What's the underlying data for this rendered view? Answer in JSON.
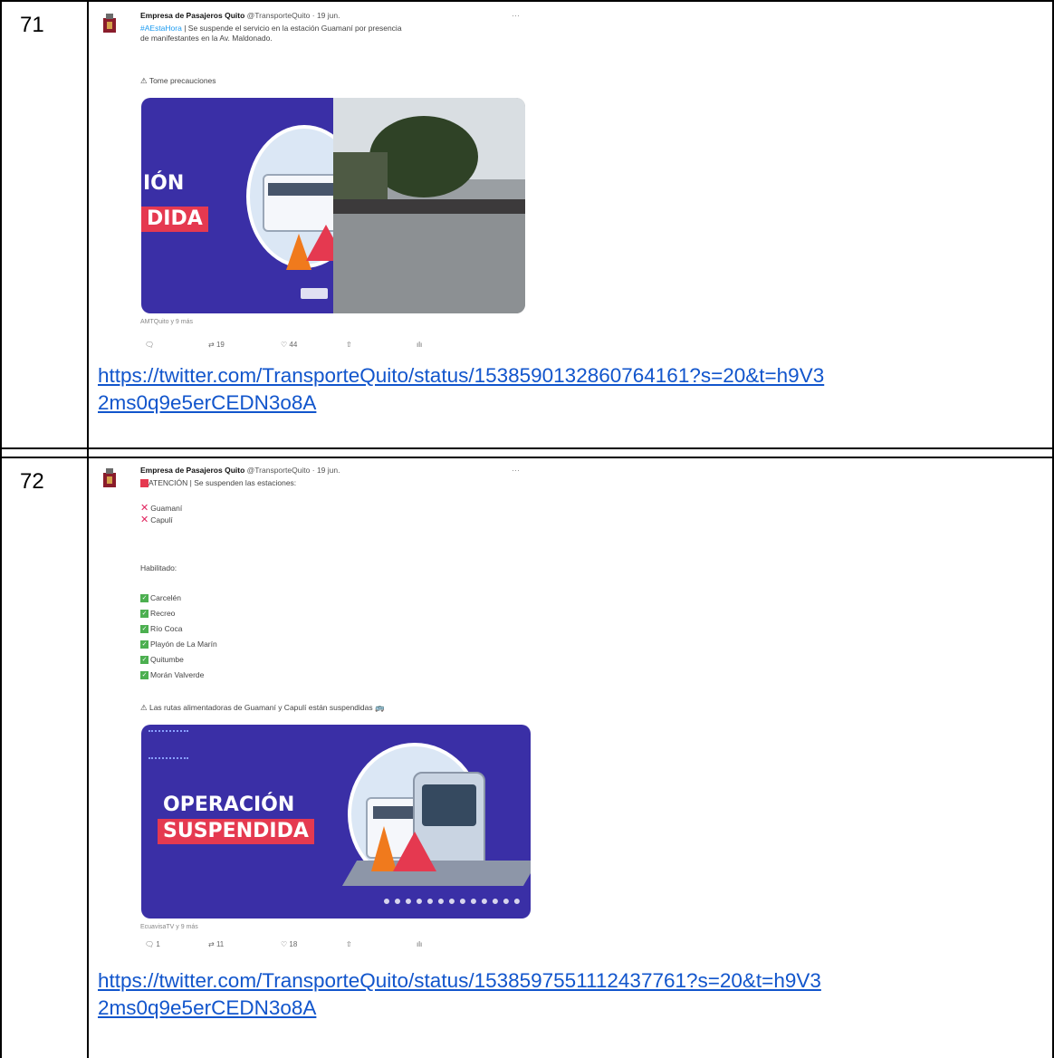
{
  "rows": [
    {
      "number": "71",
      "tweet": {
        "author": "Empresa de Pasajeros Quito",
        "handle_date": "@TransporteQuito · 19 jun.",
        "more": "···",
        "hashtag": "#AEstaHora",
        "text_line1": " | Se suspende el servicio en la estación Guamaní por presencia",
        "text_line2": "de manifestantes en la Av. Maldonado.",
        "warning": "⚠ Tome precauciones",
        "image_title_1": "IÓN",
        "image_title_2": "DIDA",
        "caption": "AMTQuito y 9 más",
        "replies": "",
        "retweets": "19",
        "likes": "44"
      },
      "url_line1": "https://twitter.com/TransporteQuito/status/1538590132860764161?s=20&t=h9V3",
      "url_line2": "2ms0q9e5erCEDN3o8A"
    },
    {
      "number": "72",
      "tweet": {
        "author": "Empresa de Pasajeros Quito",
        "handle_date": "@TransporteQuito · 19 jun.",
        "more": "···",
        "text_line1": "ATENCIÓN | Se suspenden las estaciones:",
        "suspended": [
          "Guamaní",
          "Capulí"
        ],
        "enabled_label": "Habilitado:",
        "enabled": [
          "Carcelén",
          "Recreo",
          "Río Coca",
          "Playón de La Marín",
          "Quitumbe",
          "Morán Valverde"
        ],
        "warning": "⚠ Las rutas alimentadoras de Guamaní y Capulí están suspendidas 🚌",
        "image_title_1": "OPERACIÓN",
        "image_title_2": "SUSPENDIDA",
        "caption": "EcuavisaTV y 9 más",
        "replies": "1",
        "retweets": "11",
        "likes": "18"
      },
      "url_line1": "https://twitter.com/TransporteQuito/status/1538597551112437761?s=20&t=h9V3",
      "url_line2": "2ms0q9e5erCEDN3o8A"
    }
  ]
}
